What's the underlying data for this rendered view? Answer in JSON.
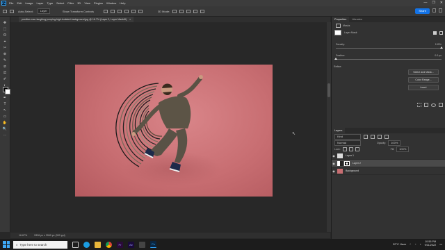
{
  "app": {
    "logo": "Ps"
  },
  "menubar": {
    "items": [
      "File",
      "Edit",
      "Image",
      "Layer",
      "Type",
      "Select",
      "Filter",
      "3D",
      "View",
      "Plugins",
      "Window",
      "Help"
    ]
  },
  "window_controls": [
    "—",
    "❐",
    "✕"
  ],
  "optionsbar": {
    "auto_select_label": "Auto-Select:",
    "auto_select_value": "Layer",
    "show_transform_label": "Show Transform Controls",
    "mode_label": "3D Mode:",
    "share_label": "Share"
  },
  "document": {
    "tab_title": "positive-man-laughing-jumping-high-isolated-background.jpg @ 16.7% (Layer 2, Layer Mask/8)",
    "close": "×",
    "zoom": "16.67%",
    "doc_size": "5336 px x 3969 px (300 ppi)"
  },
  "toolbar": {
    "tools": [
      "✥",
      "⬚",
      "ʘ",
      "⌖",
      "✂",
      "⊕",
      "✎",
      "⧄",
      "⎚",
      "✐",
      "◐",
      "⏚",
      "✒",
      "T",
      "↖",
      "▭",
      "✋",
      "🔍",
      "⋯"
    ]
  },
  "properties_panel": {
    "tabs": [
      "Properties",
      "Libraries"
    ],
    "masks_label": "Masks",
    "layer_mask_label": "Layer Mask",
    "density_label": "Density:",
    "density_value": "100%",
    "density_level": 1.0,
    "feather_label": "Feather:",
    "feather_value": "0.0 px",
    "feather_level": 0.0,
    "refine_label": "Refine:",
    "buttons": [
      "Select and Mask...",
      "Color Range...",
      "Invert"
    ]
  },
  "layers_panel": {
    "tab": "Layers",
    "filter_kind": "Kind",
    "blend_mode": "Normal",
    "opacity_label": "Opacity:",
    "opacity_value": "100%",
    "lock_label": "Lock:",
    "fill_label": "Fill:",
    "fill_value": "100%",
    "layers": [
      {
        "name": "Layer 1",
        "selected": false
      },
      {
        "name": "Layer 2",
        "selected": true
      },
      {
        "name": "Background",
        "selected": false
      }
    ]
  },
  "taskbar": {
    "search_placeholder": "Type here to search",
    "weather": "32°C  Haze",
    "time": "10:55 PM",
    "date": "9/11/2022"
  },
  "colors": {
    "accent": "#1473e6",
    "photo_bg": "#c86e72"
  }
}
